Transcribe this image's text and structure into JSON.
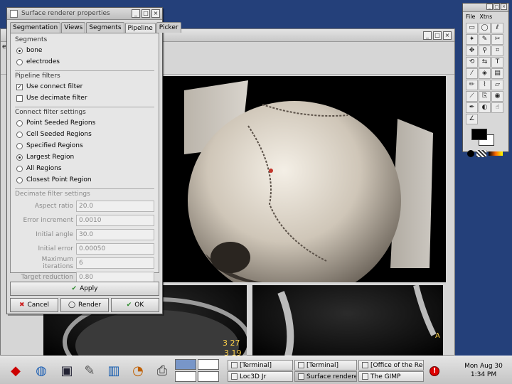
{
  "dialog": {
    "title": "Surface renderer properties",
    "tabs": [
      {
        "label": "Segmentation",
        "active": false
      },
      {
        "label": "Views",
        "active": false
      },
      {
        "label": "Segments",
        "active": false
      },
      {
        "label": "Pipeline",
        "active": true
      },
      {
        "label": "Picker",
        "active": false
      }
    ],
    "segments": {
      "label": "Segments",
      "options": [
        {
          "label": "bone",
          "selected": true
        },
        {
          "label": "electrodes",
          "selected": false
        }
      ]
    },
    "pipeline_filters": {
      "label": "Pipeline filters",
      "checks": [
        {
          "label": "Use connect filter",
          "checked": true
        },
        {
          "label": "Use decimate filter",
          "checked": false
        }
      ]
    },
    "connect_filter": {
      "label": "Connect filter settings",
      "options": [
        {
          "label": "Point Seeded Regions",
          "selected": false
        },
        {
          "label": "Cell Seeded Regions",
          "selected": false
        },
        {
          "label": "Specified Regions",
          "selected": false
        },
        {
          "label": "Largest Region",
          "selected": true
        },
        {
          "label": "All Regions",
          "selected": false
        },
        {
          "label": "Closest Point Region",
          "selected": false
        }
      ]
    },
    "decimate": {
      "label": "Decimate filter settings",
      "fields": [
        {
          "label": "Aspect ratio",
          "value": "20.0"
        },
        {
          "label": "Error increment",
          "value": "0.0010"
        },
        {
          "label": "Initial angle",
          "value": "30.0"
        },
        {
          "label": "Initial error",
          "value": "0.00050"
        },
        {
          "label": "Maximum iterations",
          "value": "6"
        },
        {
          "label": "Target reduction",
          "value": "0.80"
        }
      ]
    },
    "buttons": {
      "apply": "Apply",
      "cancel": "Cancel",
      "render": "Render",
      "ok": "OK"
    }
  },
  "viewer": {
    "menu_partial": "e",
    "annotations": [
      "3 27",
      "3 19"
    ],
    "corner_marker": "A"
  },
  "gimp": {
    "menu": [
      "File",
      "Xtns"
    ]
  },
  "taskbar": {
    "tasks": [
      {
        "label": "[Terminal]",
        "active": false
      },
      {
        "label": "[Terminal]",
        "active": false
      },
      {
        "label": "[Office of the Regis",
        "active": false
      },
      {
        "label": "Loc3D Jr",
        "active": false
      },
      {
        "label": "Surface renderer pr",
        "active": true
      },
      {
        "label": "The GIMP",
        "active": false
      }
    ],
    "clock": {
      "day": "Mon Aug 30",
      "time": "1:34 PM"
    }
  }
}
